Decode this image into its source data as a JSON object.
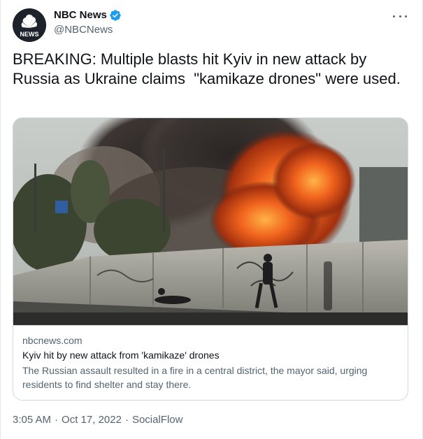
{
  "author": {
    "display_name": "NBC News",
    "handle": "@NBCNews",
    "avatar_icon": "nbc-peacock-logo",
    "avatar_label": "NEWS",
    "verified_icon": "verified-badge-icon",
    "verified_color": "#1d9bf0"
  },
  "more_icon": "more-options-icon",
  "tweet": {
    "text": "BREAKING: Multiple blasts hit Kyiv in new attack by Russia as Ukraine claims  \"kamikaze drones\" were used."
  },
  "card": {
    "image_icon": "explosion-photo",
    "domain": "nbcnews.com",
    "title": "Kyiv hit by new attack from 'kamikaze' drones",
    "description": "The Russian assault resulted in a fire in a central district, the mayor said, urging residents to find shelter and stay there."
  },
  "meta": {
    "time": "3:05 AM",
    "date": "Oct 17, 2022",
    "source": "SocialFlow",
    "separator": "·"
  }
}
